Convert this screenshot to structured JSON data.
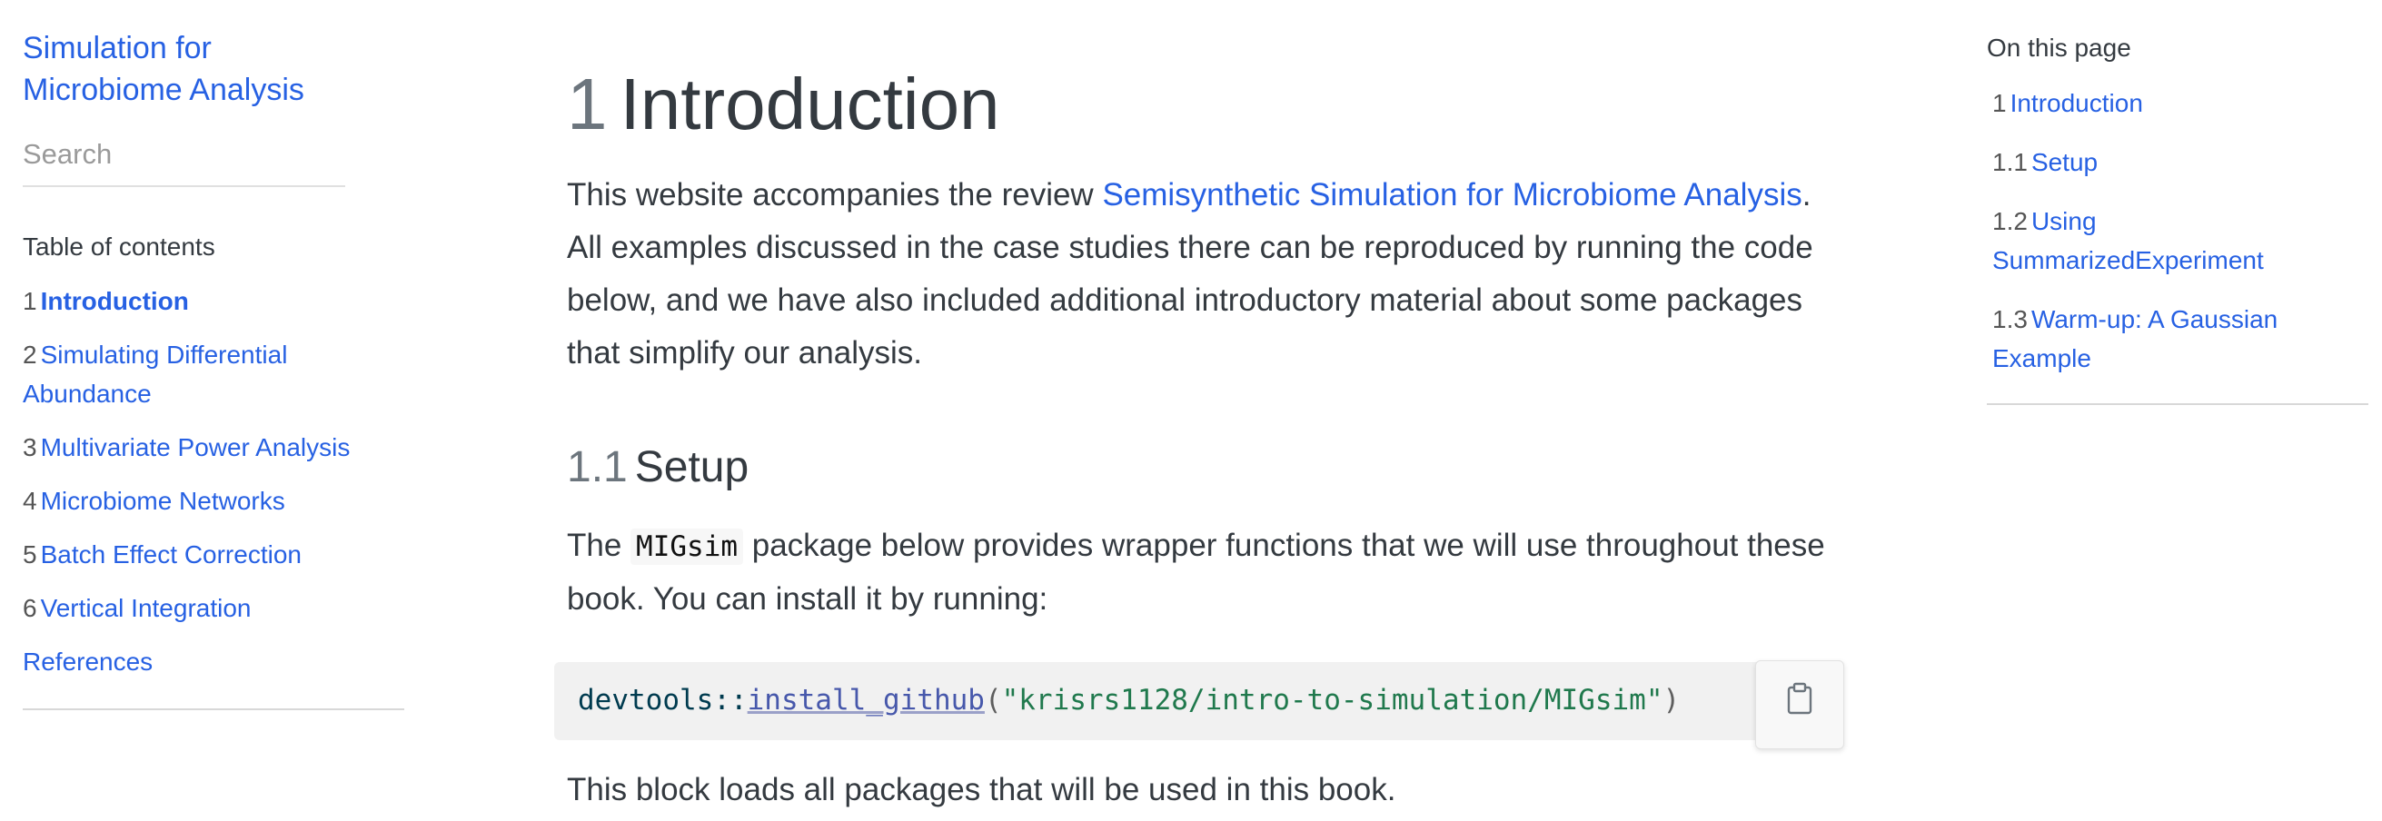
{
  "sidebar": {
    "title_line1": "Simulation for",
    "title_line2": "Microbiome Analysis",
    "search_placeholder": "Search",
    "toc_heading": "Table of contents",
    "items": [
      {
        "num": "1",
        "label": "Introduction"
      },
      {
        "num": "2",
        "label": "Simulating Differential Abundance"
      },
      {
        "num": "3",
        "label": "Multivariate Power Analysis"
      },
      {
        "num": "4",
        "label": "Microbiome Networks"
      },
      {
        "num": "5",
        "label": "Batch Effect Correction"
      },
      {
        "num": "6",
        "label": "Vertical Integration"
      },
      {
        "num": "",
        "label": "References"
      }
    ]
  },
  "main": {
    "h1_num": "1",
    "h1_text": "Introduction",
    "intro_before": "This website accompanies the review ",
    "intro_link": "Semisynthetic Simulation for Microbiome Analysis",
    "intro_after": ". All examples discussed in the case studies there can be reproduced by running the code below, and we have also included additional introductory material about some packages that simplify our analysis.",
    "h2_num": "1.1",
    "h2_text": "Setup",
    "setup_before": "The ",
    "setup_code": "MIGsim",
    "setup_after": " package below provides wrapper functions that we will use throughout these book. You can install it by running:",
    "code": {
      "ns": "devtools::",
      "fn": "install_github",
      "open": "(",
      "str": "\"krisrs1128/intro-to-simulation/MIGsim\"",
      "close": ")"
    },
    "after_code": "This block loads all packages that will be used in this book."
  },
  "right_toc": {
    "heading": "On this page",
    "items": [
      {
        "num": "1",
        "label": "Introduction"
      },
      {
        "num": "1.1",
        "label": "Setup"
      },
      {
        "num": "1.2",
        "label": "Using SummarizedExperiment"
      },
      {
        "num": "1.3",
        "label": "Warm-up: A Gaussian Example"
      }
    ]
  },
  "colors": {
    "link": "#2761e3",
    "text": "#343a40",
    "muted": "#6c757d",
    "code_bg": "#f1f1f1",
    "string": "#20794d"
  },
  "icons": {
    "copy": "clipboard-icon"
  }
}
